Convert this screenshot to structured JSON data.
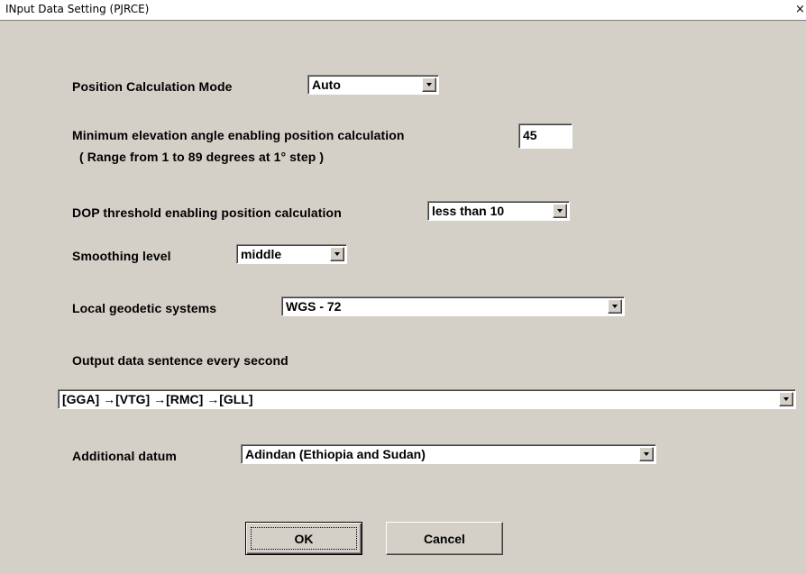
{
  "window": {
    "title": "INput Data Setting (PJRCE)",
    "close_glyph": "×"
  },
  "form": {
    "position_mode": {
      "label": "Position Calculation Mode",
      "value": "Auto"
    },
    "min_elevation": {
      "label": "Minimum elevation angle enabling position calculation",
      "value": "45",
      "hint": "( Range from 1 to 89 degrees at 1°  step )"
    },
    "dop_threshold": {
      "label": "DOP threshold enabling position calculation",
      "value": "less than 10"
    },
    "smoothing": {
      "label": "Smoothing level",
      "value": "middle"
    },
    "geodetic": {
      "label": "Local geodetic systems",
      "value": "WGS - 72"
    },
    "output_sentence": {
      "label": "Output data sentence every second",
      "value": "[GGA] →[VTG] →[RMC] →[GLL]"
    },
    "additional_datum": {
      "label": "Additional datum",
      "value": "Adindan (Ethiopia and Sudan)"
    }
  },
  "buttons": {
    "ok": "OK",
    "cancel": "Cancel"
  },
  "icons": {
    "close": "close-icon",
    "dropdown": "chevron-down-icon"
  },
  "colors": {
    "dialog_bg": "#d4d0c8",
    "titlebar_bg": "#ffffff"
  }
}
